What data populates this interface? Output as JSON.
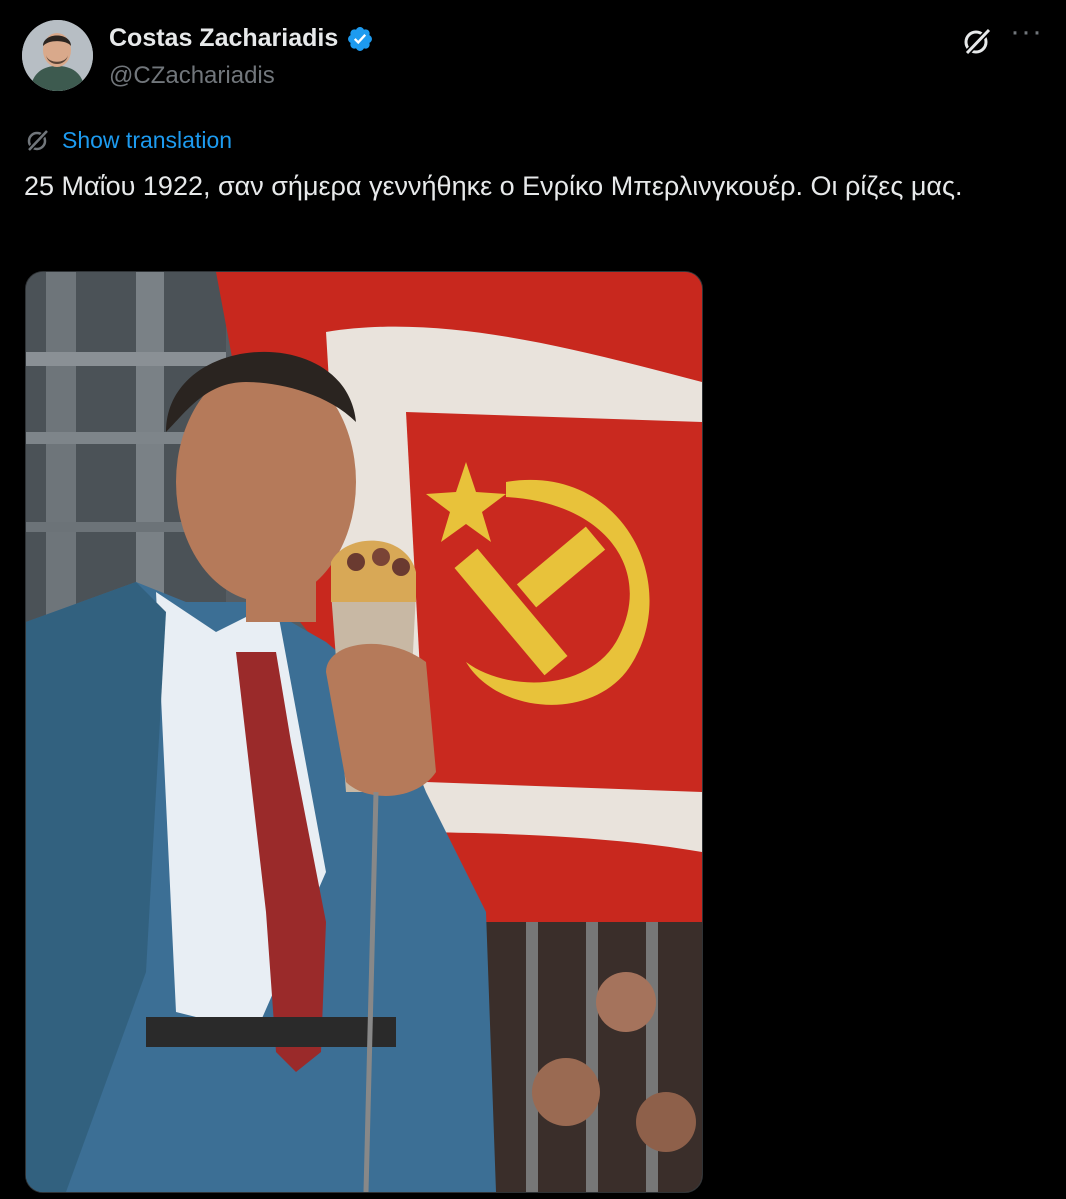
{
  "tweet": {
    "author": {
      "display_name": "Costas Zachariadis",
      "handle": "@CZachariadis",
      "verified": true,
      "verified_color": "#1d9bf0"
    },
    "translate_label": "Show translation",
    "text": "25 Μαΐου 1922, σαν σήμερα γεννήθηκε ο Ενρίκο Μπερλινγκουέρ. Οι ρίζες μας.",
    "icons": {
      "header_right": [
        "grok-icon",
        "more-icon"
      ],
      "translate": "translate-icon"
    },
    "colors": {
      "background": "#000000",
      "text": "#e7e9ea",
      "secondary": "#71767b",
      "link": "#1d9bf0"
    }
  }
}
